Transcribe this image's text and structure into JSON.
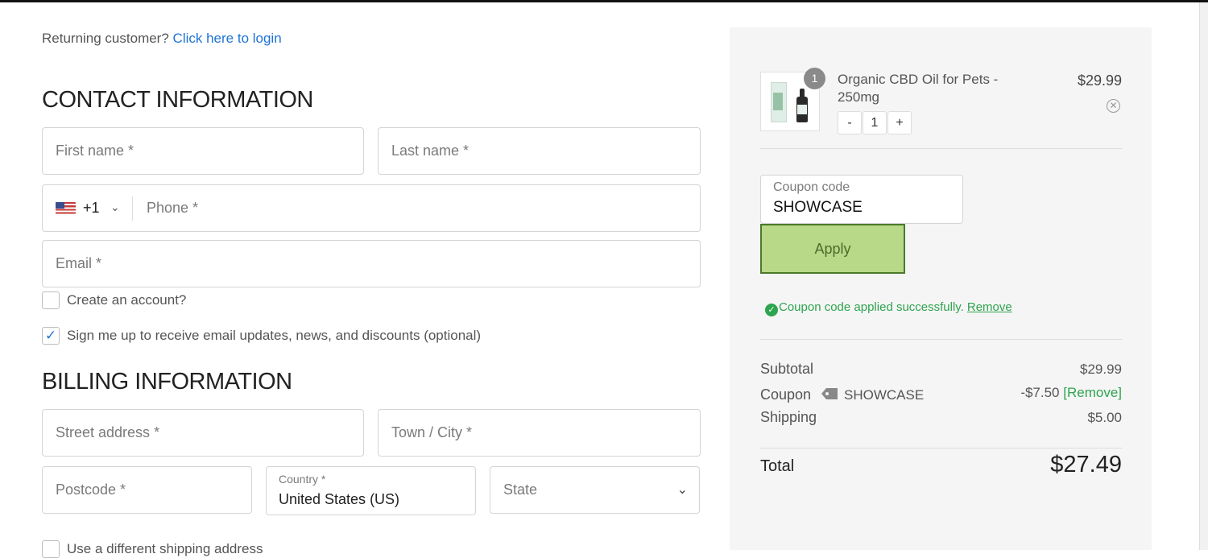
{
  "returning": {
    "text": "Returning customer?",
    "link": "Click here to login"
  },
  "contact": {
    "title": "CONTACT INFORMATION",
    "first_name_placeholder": "First name *",
    "last_name_placeholder": "Last name *",
    "phone_country_code": "+1",
    "phone_placeholder": "Phone *",
    "email_placeholder": "Email *",
    "create_account_label": "Create an account?",
    "create_account_checked": false,
    "newsletter_label": "Sign me up to receive email updates, news, and discounts (optional)",
    "newsletter_checked": true
  },
  "billing": {
    "title": "BILLING INFORMATION",
    "street_placeholder": "Street address *",
    "city_placeholder": "Town / City *",
    "postcode_placeholder": "Postcode *",
    "country_label": "Country *",
    "country_value": "United States (US)",
    "state_placeholder": "State",
    "different_shipping_label": "Use a different shipping address"
  },
  "cart": {
    "item": {
      "name": "Organic CBD Oil for Pets - 250mg",
      "price": "$29.99",
      "badge_qty": "1",
      "qty": "1",
      "minus": "-",
      "plus": "+",
      "remove_icon": "close-circle-icon"
    },
    "coupon": {
      "label": "Coupon code",
      "value": "SHOWCASE",
      "apply_label": "Apply",
      "success_message": "Coupon code applied successfully.",
      "remove_label": "Remove"
    },
    "totals": {
      "subtotal_label": "Subtotal",
      "subtotal_value": "$29.99",
      "coupon_label": "Coupon",
      "coupon_code": "SHOWCASE",
      "coupon_value": "-$7.50",
      "coupon_remove": "[Remove]",
      "shipping_label": "Shipping",
      "shipping_value": "$5.00",
      "total_label": "Total",
      "total_value": "$27.49"
    }
  },
  "colors": {
    "link": "#1f73d6",
    "success": "#2ea44f",
    "apply_bg": "#b8d987",
    "apply_border": "#4a7a2a"
  }
}
